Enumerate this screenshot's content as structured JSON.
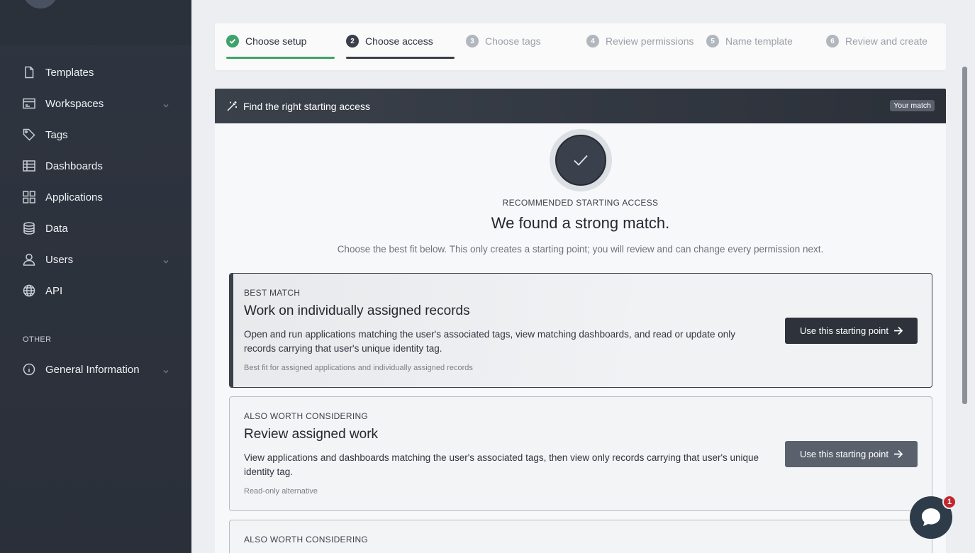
{
  "sidebar": {
    "items": [
      {
        "label": "Templates",
        "icon": "file-icon"
      },
      {
        "label": "Workspaces",
        "icon": "browser-window-icon",
        "has_chevron": true
      },
      {
        "label": "Tags",
        "icon": "tag-icon"
      },
      {
        "label": "Dashboards",
        "icon": "table-grid-icon"
      },
      {
        "label": "Applications",
        "icon": "apps-grid-icon"
      },
      {
        "label": "Data",
        "icon": "database-icon"
      },
      {
        "label": "Users",
        "icon": "user-icon",
        "has_chevron": true
      },
      {
        "label": "API",
        "icon": "globe-icon"
      }
    ],
    "section_other": "OTHER",
    "other_items": [
      {
        "label": "General Information",
        "icon": "info-circle-icon",
        "has_chevron": true
      }
    ]
  },
  "stepper": {
    "steps": [
      {
        "num": "1",
        "label": "Choose setup",
        "state": "done"
      },
      {
        "num": "2",
        "label": "Choose access",
        "state": "active"
      },
      {
        "num": "3",
        "label": "Choose tags",
        "state": "pending"
      },
      {
        "num": "4",
        "label": "Review permissions",
        "state": "pending"
      },
      {
        "num": "5",
        "label": "Name template",
        "state": "pending"
      },
      {
        "num": "6",
        "label": "Review and create",
        "state": "pending"
      }
    ],
    "colors": {
      "done": "#3ea36a",
      "active": "#3a4049"
    }
  },
  "banner": {
    "title": "Find the right starting access",
    "badge": "Your match"
  },
  "recommendation": {
    "label": "RECOMMENDED STARTING ACCESS",
    "title": "We found a strong match.",
    "subtitle": "Choose the best fit below. This only creates a starting point; you will review and can change every permission next."
  },
  "cards": [
    {
      "kicker": "BEST MATCH",
      "title": "Work on individually assigned records",
      "description": "Open and run applications matching the user's associated tags, view matching dashboards, and read or update only records carrying that user's unique identity tag.",
      "footnote": "Best fit for assigned applications and individually assigned records",
      "button": "Use this starting point"
    },
    {
      "kicker": "ALSO WORTH CONSIDERING",
      "title": "Review assigned work",
      "description": "View applications and dashboards matching the user's associated tags, then view only records carrying that user's unique identity tag.",
      "footnote": "Read-only alternative",
      "button": "Use this starting point"
    },
    {
      "kicker": "ALSO WORTH CONSIDERING"
    }
  ],
  "chat": {
    "unread": "1"
  }
}
